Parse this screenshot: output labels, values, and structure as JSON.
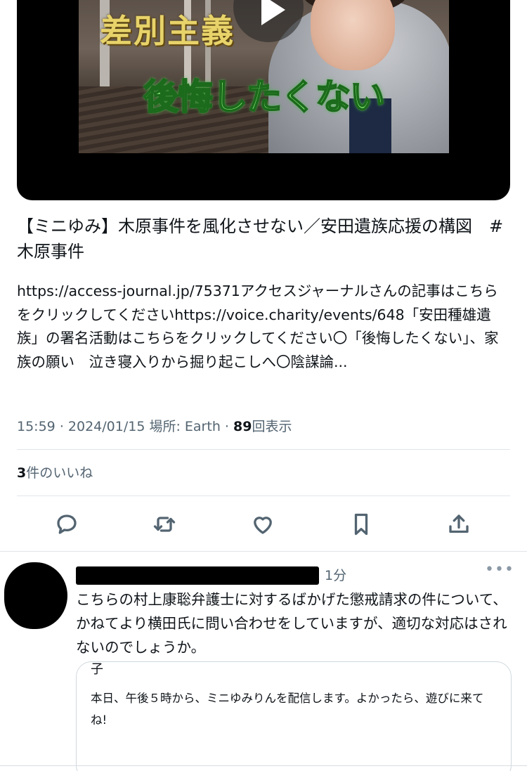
{
  "video": {
    "thumbnail_text_top": "差別主義",
    "thumbnail_text_main": "後悔したくない"
  },
  "post": {
    "title": "【ミニゆみ】木原事件を風化させない／安田遺族応援の構図　#木原事件",
    "description": "https://access-journal.jp/75371アクセスジャーナルさんの記事はこちらをクリックしてくださいhttps://voice.charity/events/648「安田種雄遺族」の署名活動はこちらをクリックしてください〇「後悔したくない」、家族の願い　泣き寝入りから掘り起こしへ〇陰謀論...",
    "meta": {
      "time": "15:59",
      "date": "2024/01/15",
      "location_label": "場所: Earth",
      "views": "89",
      "views_label": "回表示",
      "separator": "·"
    },
    "likes": {
      "count": "3",
      "label": "件のいいね"
    }
  },
  "actions": [
    {
      "name": "reply",
      "icon": "reply-icon"
    },
    {
      "name": "retweet",
      "icon": "retweet-icon"
    },
    {
      "name": "like",
      "icon": "heart-icon"
    },
    {
      "name": "bookmark",
      "icon": "bookmark-icon"
    },
    {
      "name": "share",
      "icon": "share-icon"
    }
  ],
  "reply": {
    "time": "1分",
    "more": "•••",
    "text": "こちらの村上康聡弁護士に対するばかげた懲戒請求の件について、かねてより横田氏に問い合わせをしていますが、適切な対応はされないのでしょうか。",
    "quote": {
      "head": "子",
      "text": "本日、午後５時から、ミニゆみりんを配信します。よかったら、遊びに来てね!"
    }
  }
}
